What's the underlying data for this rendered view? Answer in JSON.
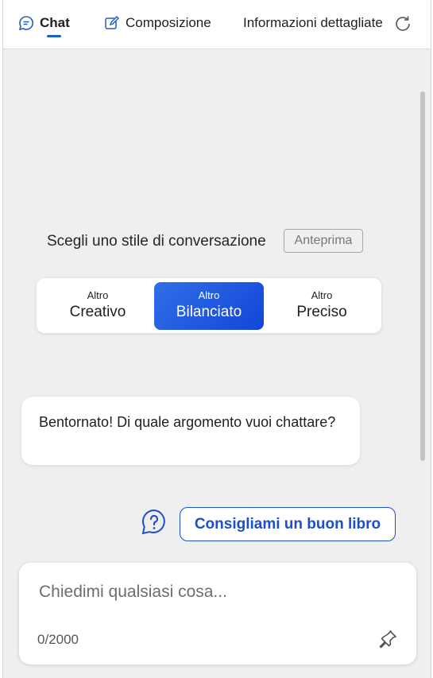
{
  "tabs": {
    "chat": "Chat",
    "compose": "Composizione",
    "insights": "Informazioni dettagliate"
  },
  "conversation_style": {
    "label": "Scegli uno stile di conversazione",
    "badge": "Anteprima",
    "options": [
      {
        "small": "Altro",
        "name": "Creativo"
      },
      {
        "small": "Altro",
        "name": "Bilanciato"
      },
      {
        "small": "Altro",
        "name": "Preciso"
      }
    ],
    "selected": "Bilanciato"
  },
  "messages": {
    "bot_greeting": "Bentornato! Di quale argomento vuoi chattare?"
  },
  "suggestion": {
    "label": "Consigliami un buon libro"
  },
  "input": {
    "placeholder": "Chiedimi qualsiasi cosa...",
    "counter": "0/2000"
  },
  "colors": {
    "accent": "#1d4fc9",
    "selected_gradient_start": "#2f6fe8",
    "selected_gradient_end": "#1346d8",
    "background": "#efefef"
  }
}
